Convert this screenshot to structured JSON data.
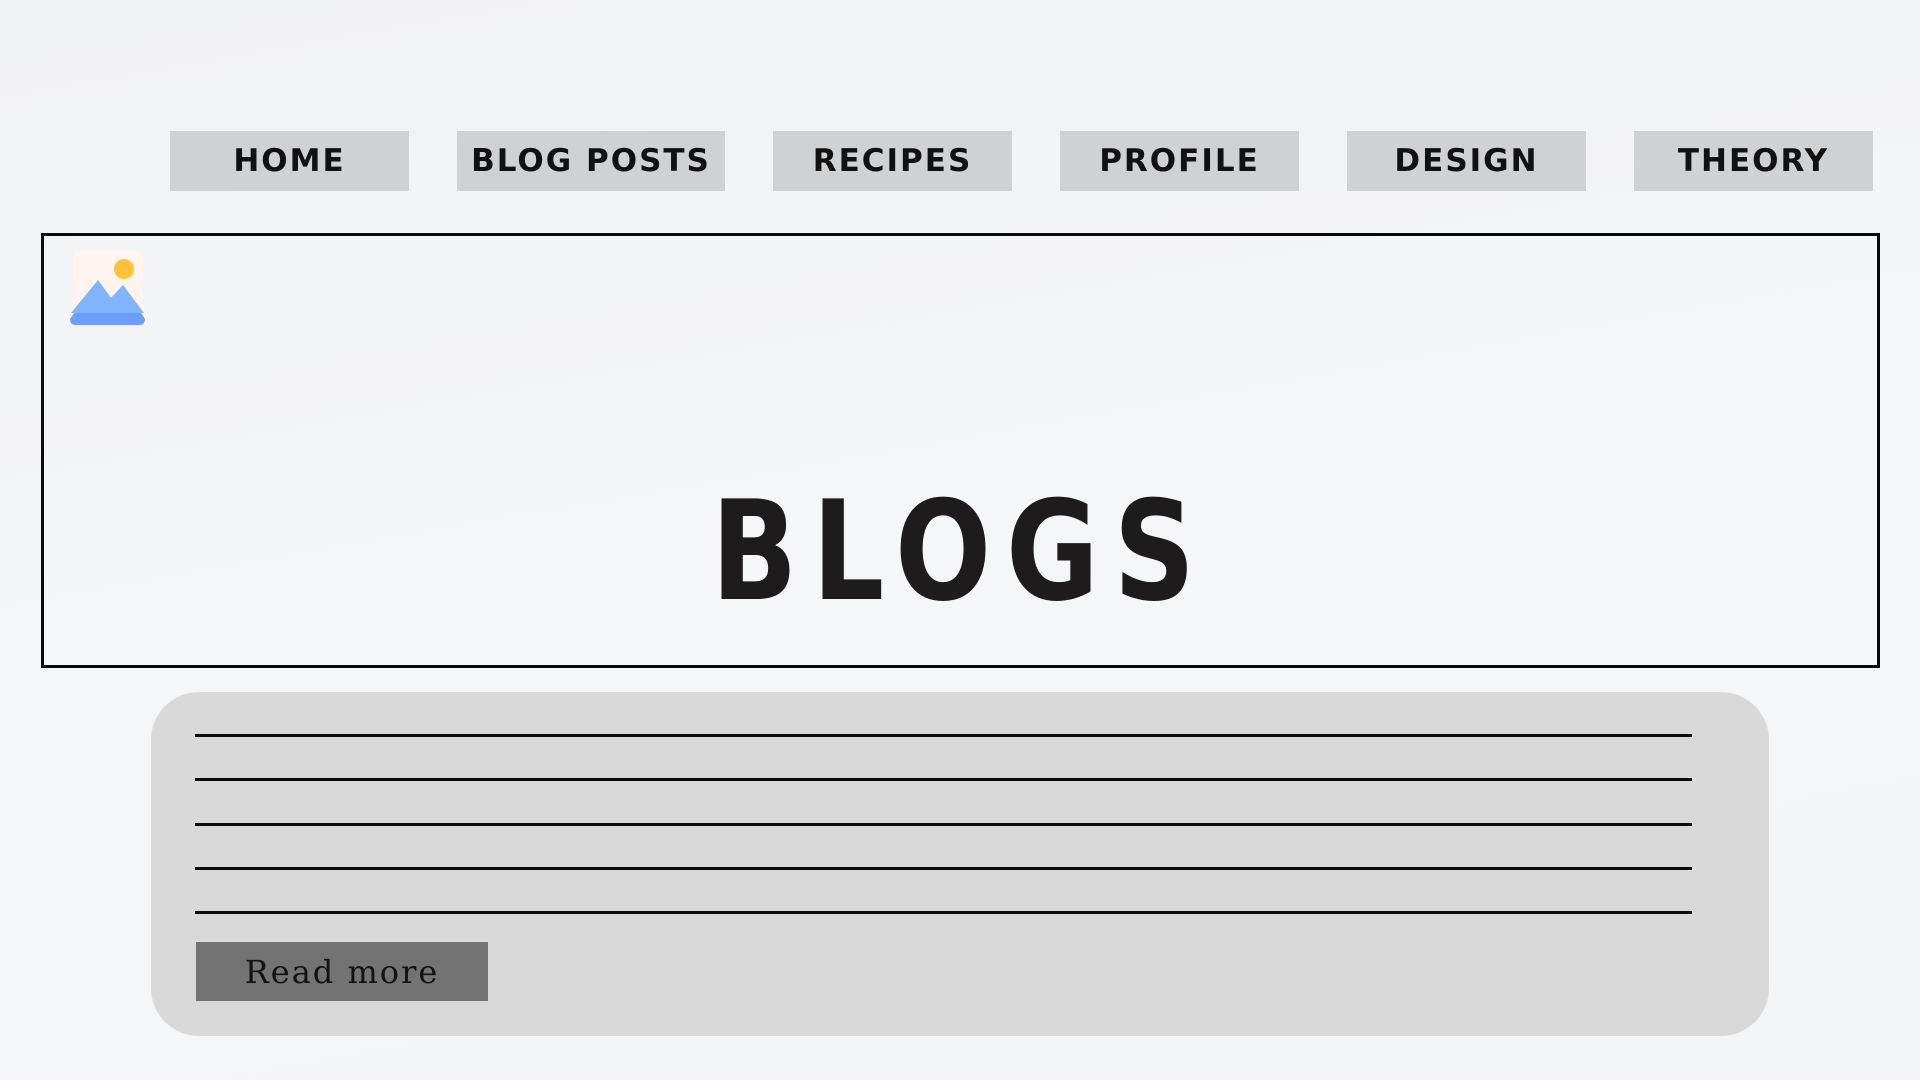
{
  "nav": {
    "items": [
      {
        "label": "HOME"
      },
      {
        "label": "BLOG POSTS"
      },
      {
        "label": "RECIPES"
      },
      {
        "label": "PROFILE"
      },
      {
        "label": "DESIGN"
      },
      {
        "label": "THEORY"
      }
    ]
  },
  "hero": {
    "title": "BLOGS",
    "icon": "image-placeholder-icon"
  },
  "card": {
    "read_more_label": "Read more"
  },
  "colors": {
    "nav_bg": "#d0d1d3",
    "card_bg": "#d9d9d9",
    "button_bg": "#737373",
    "text": "#111111"
  }
}
